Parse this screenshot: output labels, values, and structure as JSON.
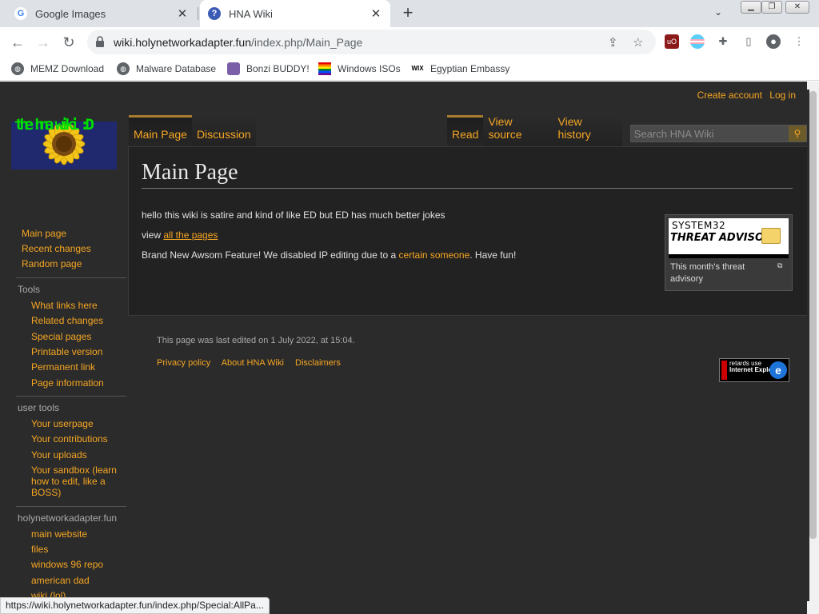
{
  "browser": {
    "tabs": [
      {
        "title": "Google Images",
        "favicon": "G",
        "active": false
      },
      {
        "title": "HNA Wiki",
        "favicon": "?",
        "active": true
      }
    ],
    "new_tab": "+",
    "url_host": "wiki.holynetworkadapter.fun",
    "url_path": "/index.php/Main_Page",
    "bookmarks": [
      {
        "label": "MEMZ Download",
        "icon": "globe-icon"
      },
      {
        "label": "Malware Database",
        "icon": "globe-icon"
      },
      {
        "label": "Bonzi BUDDY!",
        "icon": "bonzi-icon"
      },
      {
        "label": "Windows ISOs",
        "icon": "rainbow-flag-icon"
      },
      {
        "label": "Egyptian Embassy",
        "icon": "wix-icon"
      }
    ],
    "status_url": "https://wiki.holynetworkadapter.fun/index.php/Special:AllPa..."
  },
  "wiki": {
    "personal": {
      "create_account": "Create account",
      "login": "Log in"
    },
    "logo_text": "the hna wiki :D",
    "namespaces": {
      "main_page": "Main Page",
      "discussion": "Discussion"
    },
    "views": {
      "read": "Read",
      "view_source": "View source",
      "view_history": "View history"
    },
    "search_placeholder": "Search HNA Wiki",
    "heading": "Main Page",
    "body": {
      "p1": "hello this wiki is satire and kind of like ED but ED has much better jokes",
      "p2_prefix": "view ",
      "p2_link": "all the pages",
      "p3_prefix": "Brand New Awsom Feature! We disabled IP editing due to a ",
      "p3_link": "certain someone",
      "p3_suffix": ". Have fun!"
    },
    "thumb": {
      "line1": "SYSTEM32",
      "line2": "THREAT ADVISORY",
      "caption": "This month's threat advisory"
    },
    "navigation": [
      "Main page",
      "Recent changes",
      "Random page"
    ],
    "tools": {
      "heading": "Tools",
      "items": [
        "What links here",
        "Related changes",
        "Special pages",
        "Printable version",
        "Permanent link",
        "Page information"
      ]
    },
    "user_tools": {
      "heading": "user tools",
      "items": [
        "Your userpage",
        "Your contributions",
        "Your uploads",
        "Your sandbox (learn how to edit, like a BOSS)"
      ]
    },
    "hna": {
      "heading": "holynetworkadapter.fun",
      "items": [
        "main website",
        "files",
        "windows 96 repo",
        "american dad",
        "wiki (lol)"
      ]
    },
    "footer": {
      "last_edited": "This page was last edited on 1 July 2022, at 15:04.",
      "privacy": "Privacy policy",
      "about": "About HNA Wiki",
      "disclaimers": "Disclaimers",
      "badge_line1": "retards use",
      "badge_line2": "Internet Explorer",
      "badge_side": "ONLY"
    }
  }
}
